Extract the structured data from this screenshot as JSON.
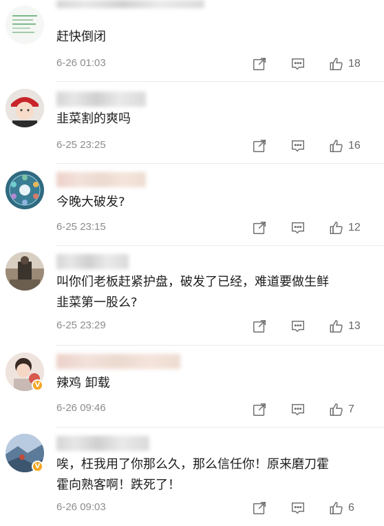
{
  "comments": [
    {
      "text": "赶快倒闭",
      "time": "6-26 01:03",
      "likes": "18",
      "verified": false
    },
    {
      "text": "韭菜割的爽吗",
      "time": "6-25 23:25",
      "likes": "16",
      "verified": false
    },
    {
      "text": "今晚大破发?",
      "time": "6-25 23:15",
      "likes": "12",
      "verified": false
    },
    {
      "text": "叫你们老板赶紧护盘，破发了已经，难道要做生鲜\n韭菜第一股么?",
      "time": "6-25 23:29",
      "likes": "13",
      "verified": false
    },
    {
      "text": "辣鸡 卸载",
      "time": "6-26 09:46",
      "likes": "7",
      "verified": true
    },
    {
      "text": "唉，枉我用了你那么久，那么信任你！原来磨刀霍\n霍向熟客啊！跌死了！",
      "time": "6-26 09:03",
      "likes": "6",
      "verified": true
    }
  ],
  "icons": {
    "share": "share-icon",
    "comment": "comment-icon",
    "like": "thumbs-up-icon",
    "verified": "verified-badge-icon"
  },
  "colors": {
    "text": "#1d1d1d",
    "meta": "#8c8c8c",
    "icon": "#6e6e6e",
    "divider": "#ececec",
    "verified_badge": "#f5a623"
  }
}
